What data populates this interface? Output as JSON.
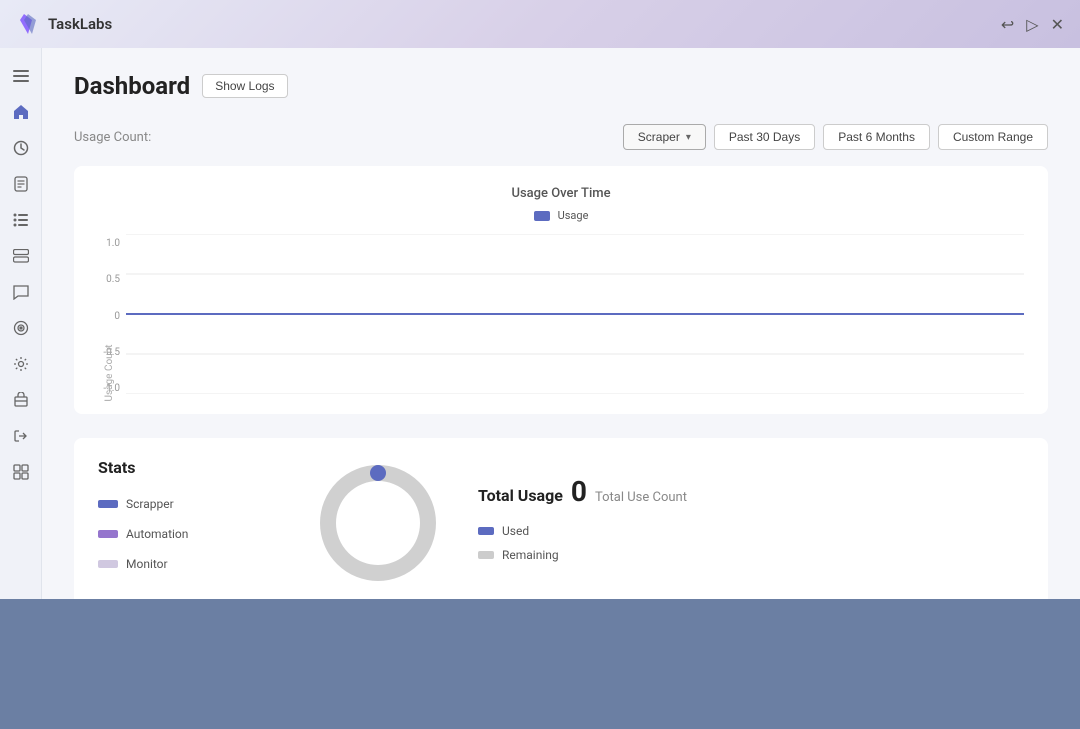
{
  "app": {
    "name": "TaskLabs"
  },
  "topbar": {
    "title": "TaskLabs",
    "actions": [
      "undo",
      "forward",
      "close"
    ]
  },
  "sidebar": {
    "items": [
      {
        "id": "menu",
        "icon": "☰",
        "label": "Menu"
      },
      {
        "id": "home",
        "icon": "⌂",
        "label": "Home"
      },
      {
        "id": "clock",
        "icon": "◷",
        "label": "Time"
      },
      {
        "id": "doc",
        "icon": "📄",
        "label": "Documents"
      },
      {
        "id": "list",
        "icon": "☰",
        "label": "List"
      },
      {
        "id": "card",
        "icon": "▤",
        "label": "Card"
      },
      {
        "id": "chat",
        "icon": "💬",
        "label": "Chat"
      },
      {
        "id": "target",
        "icon": "◎",
        "label": "Target"
      },
      {
        "id": "settings",
        "icon": "⚙",
        "label": "Settings"
      },
      {
        "id": "package",
        "icon": "📦",
        "label": "Package"
      },
      {
        "id": "login",
        "icon": "→",
        "label": "Login"
      },
      {
        "id": "grid",
        "icon": "⊞",
        "label": "Grid"
      }
    ]
  },
  "dashboard": {
    "title": "Dashboard",
    "show_logs_label": "Show Logs",
    "usage_count_label": "Usage Count:",
    "scraper_dropdown_label": "Scraper",
    "past_30_days_label": "Past 30 Days",
    "past_6_months_label": "Past 6 Months",
    "custom_range_label": "Custom Range",
    "chart": {
      "title": "Usage Over Time",
      "legend_label": "Usage",
      "y_label": "Usage Count",
      "y_ticks": [
        "1.0",
        "0.5",
        "0",
        "-0.5",
        "-1.0"
      ],
      "line_color": "#5c6bc0",
      "data_value": 0
    },
    "stats": {
      "title": "Stats",
      "legend_items": [
        {
          "label": "Scrapper",
          "color": "#5c6bc0"
        },
        {
          "label": "Automation",
          "color": "#9575cd"
        },
        {
          "label": "Monitor",
          "color": "#d0c8e0"
        }
      ],
      "total_usage": {
        "title": "Total Usage",
        "count": "0",
        "label": "Total Use Count",
        "legend_items": [
          {
            "label": "Used",
            "color": "#5c6bc0"
          },
          {
            "label": "Remaining",
            "color": "#cccccc"
          }
        ]
      }
    }
  },
  "colors": {
    "accent": "#5c6bc0",
    "accent_light": "#9575cd",
    "accent_faint": "#d0c8e0",
    "donut_remaining": "#d0d0d0",
    "chart_line": "#5c6bc0"
  }
}
